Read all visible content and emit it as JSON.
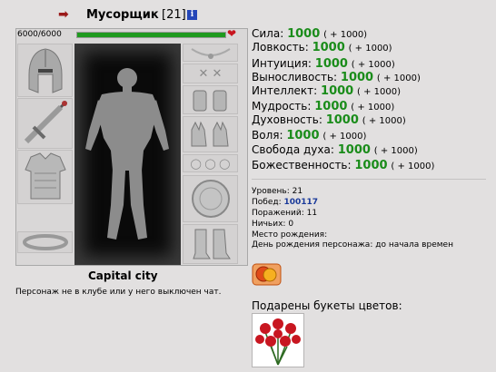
{
  "header": {
    "name": "Мусорщик",
    "level": "[21]",
    "info_glyph": "i"
  },
  "hp": {
    "text": "6000/6000",
    "fraction": 1.0,
    "bar_color": "#1f9a1f"
  },
  "icons": {
    "back": "back-arrow-icon",
    "info": "info-icon",
    "heart": "heart-icon"
  },
  "stats": [
    {
      "label": "Сила:",
      "value": "1000",
      "bonus": "( + 1000)"
    },
    {
      "label": "Ловкость:",
      "value": "1000",
      "bonus": "( + 1000)"
    },
    {
      "label": "Интуиция:",
      "value": "1000",
      "bonus": "( + 1000)"
    },
    {
      "label": "Выносливость:",
      "value": "1000",
      "bonus": "( + 1000)"
    },
    {
      "label": "Интеллект:",
      "value": "1000",
      "bonus": "( + 1000)"
    },
    {
      "label": "Мудрость:",
      "value": "1000",
      "bonus": "( + 1000)"
    },
    {
      "label": "Духовность:",
      "value": "1000",
      "bonus": "( + 1000)"
    },
    {
      "label": "Воля:",
      "value": "1000",
      "bonus": "( + 1000)"
    },
    {
      "label": "Свобода духа:",
      "value": "1000",
      "bonus": "( + 1000)"
    },
    {
      "label": "Божественность:",
      "value": "1000",
      "bonus": "( + 1000)"
    }
  ],
  "info": {
    "level_label": "Уровень:",
    "level_value": "21",
    "wins_label": "Побед:",
    "wins_value": "100117",
    "losses_label": "Поражений:",
    "losses_value": "11",
    "draws_label": "Ничьих:",
    "draws_value": "0",
    "birthplace_label": "Место рождения:",
    "birthday_label": "День рождения персонажа:",
    "birthday_value": "до начала времен"
  },
  "city": "Capital city",
  "clan_note": "Персонаж не в клубе или у него выключен чат.",
  "flowers_title": "Подарены букеты цветов:",
  "colors": {
    "stat_value": "#1a8c1a",
    "wins_value": "#1a3a9a",
    "background": "#e2e0e0"
  }
}
